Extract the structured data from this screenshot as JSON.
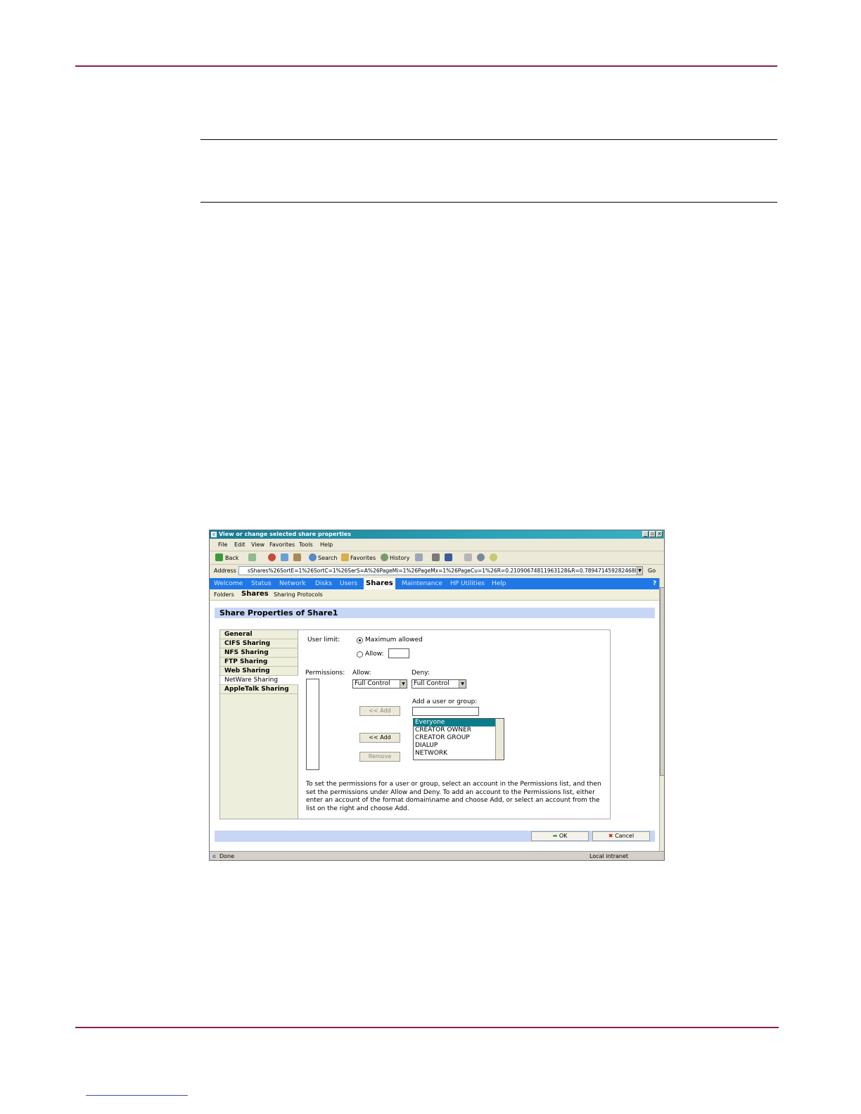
{
  "window": {
    "title": "View or change selected share properties",
    "menu": [
      "File",
      "Edit",
      "View",
      "Favorites",
      "Tools",
      "Help"
    ],
    "toolbar": {
      "back": "Back",
      "search": "Search",
      "favorites": "Favorites",
      "history": "History"
    },
    "address_label": "Address",
    "address": "sShares%26SortE=1%26SortC=1%26SerS=A%26PageMi=1%26PageMx=1%26PageCu=1%26R=0.21090674811963128&R=0.789471459282468l",
    "go": "Go",
    "status_left": "Done",
    "status_right": "Local intranet"
  },
  "nav": {
    "tabs": [
      "Welcome",
      "Status",
      "Network",
      "Disks",
      "Users",
      "Shares",
      "Maintenance",
      "HP Utilities",
      "Help"
    ],
    "active": "Shares",
    "help_glyph": "?"
  },
  "subnav": {
    "items": [
      "Folders",
      "Shares",
      "Sharing Protocols"
    ],
    "active": "Shares"
  },
  "page": {
    "heading": "Share Properties of Share1",
    "sidebar": [
      "General",
      "CIFS Sharing",
      "NFS Sharing",
      "FTP Sharing",
      "Web Sharing",
      "NetWare Sharing",
      "AppleTalk Sharing"
    ],
    "user_limit_label": "User limit:",
    "max_allowed_label": "Maximum allowed",
    "allow_label": "Allow:",
    "permissions_label": "Permissions:",
    "allow_col_label": "Allow:",
    "deny_col_label": "Deny:",
    "allow_value": "Full Control",
    "deny_value": "Full Control",
    "add_user_label": "Add a user or group:",
    "add_button_1": "<< Add",
    "add_button_2": "<< Add",
    "remove_button": "Remove",
    "users": [
      "Everyone",
      "CREATOR OWNER",
      "CREATOR GROUP",
      "DIALUP",
      "NETWORK"
    ],
    "help_text": "To set the permissions for a user or group, select an account in the Permissions list, and then set the permissions under Allow and Deny. To add an account to the Permissions list, either enter an account of the format domain\\name and choose Add, or select an account from the list on the right and choose Add.",
    "ok": "OK",
    "cancel": "Cancel"
  },
  "colors": {
    "rule": "#8a2050",
    "nav_bar": "#1f78e6",
    "section_header": "#c8d6f5",
    "selected_user": "#0a7d8c"
  }
}
